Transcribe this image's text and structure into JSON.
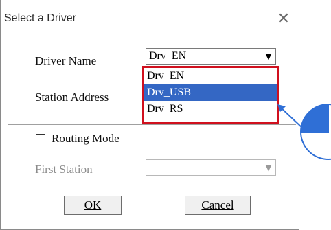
{
  "dialog": {
    "title": "Select a Driver",
    "close_icon": "close-icon"
  },
  "driver": {
    "label": "Driver Name",
    "selected": "Drv_EN",
    "options": [
      "Drv_EN",
      "Drv_USB",
      "Drv_RS"
    ],
    "highlighted_option": "Drv_USB"
  },
  "station": {
    "label": "Station Address"
  },
  "routing": {
    "label": "Routing Mode",
    "checked": false
  },
  "first_station": {
    "label": "First Station",
    "value": ""
  },
  "buttons": {
    "ok": "OK",
    "cancel": "Cancel"
  },
  "colors": {
    "highlight_border": "#d0101e",
    "selection": "#3467c4",
    "callout": "#2f6fd6"
  }
}
